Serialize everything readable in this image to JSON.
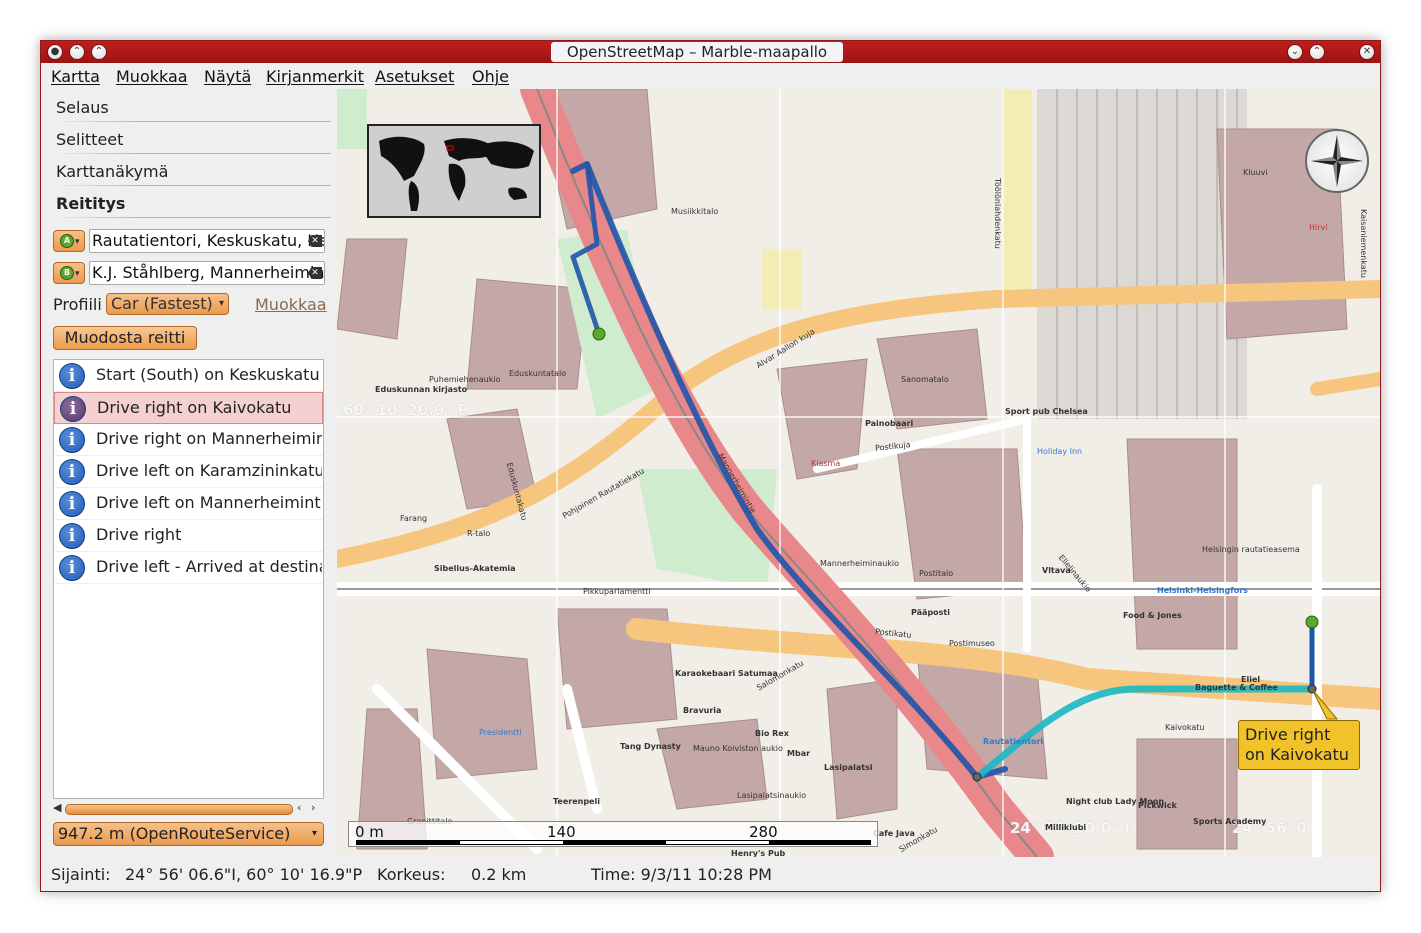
{
  "window": {
    "title": "OpenStreetMap – Marble-maapallo"
  },
  "menu": [
    "Kartta",
    "Muokkaa",
    "Näytä",
    "Kirjanmerkit",
    "Asetukset",
    "Ohje"
  ],
  "panel_tabs": [
    "Selaus",
    "Selitteet",
    "Karttanäkymä",
    "Reititys"
  ],
  "routing": {
    "start": "Rautatientori, Keskuskatu, Helsinki",
    "end": "K.J. Ståhlberg, Mannerheimintie",
    "start_pin": "A",
    "end_pin": "B",
    "profile_label": "Profiili",
    "profile": "Car (Fastest)",
    "edit_label": "Muokkaa",
    "calc_button": "Muodosta reitti",
    "instructions": [
      "Start (South) on Keskuskatu",
      "Drive right on Kaivokatu",
      "Drive right on Mannerheimintie",
      "Drive left on Karamzininkatu",
      "Drive left on Mannerheimintie",
      "Drive right",
      "Drive left - Arrived at destination"
    ],
    "selected_index": 1,
    "service": "947.2 m (OpenRouteService)"
  },
  "map": {
    "callout": "Drive right on Kaivokatu",
    "scale_labels": [
      "0 m",
      "140",
      "280"
    ],
    "grid_labels": [
      "60° 10' 20.0\" P",
      "24° 56' 20.0\" I",
      "24° 56' 0"
    ],
    "street_labels": [
      "Mannerheimintie",
      "Alvar Aallon kuja",
      "Postikatu",
      "Kaivokatu",
      "Salomonkatu",
      "Pohjoinen Rautatiekatu",
      "Eduskuntakatu",
      "Elielinaukio",
      "Postikuja",
      "Töölönlahdenkatu",
      "Kaisaniemenkatu",
      "Simonkatu",
      "Lasipalatsinaukio"
    ],
    "poi_labels": [
      "Musiikkitalo",
      "Eduskunnan kirjasto",
      "Puhemiehenaukio",
      "Eduskuntatalo",
      "Sanomatalo",
      "Painobaari",
      "Kiasma",
      "Sibelius-Akatemia",
      "R-talo",
      "Farang",
      "Pikkuparlamentti",
      "Mannerheiminaukio",
      "Postitalo",
      "Pääposti",
      "Holiday Inn",
      "Helsinki-Helsingfors",
      "Helsingin rautatieasema",
      "Vltava",
      "Sport pub Chelsea",
      "Food & Jones",
      "Eliel",
      "Baguette & Coffee",
      "Rautatientori",
      "Karaokebaari Satumaa",
      "Bravuria",
      "Tang Dynasty",
      "Bio Rex",
      "Mbar",
      "Lasipalatsi",
      "Mauno Koiviston aukio",
      "Presidentti",
      "Teerenpeli",
      "Granittitalo",
      "Cafe Java",
      "Henry's Pub",
      "Milliklubi",
      "Night club Lady Moon",
      "Pickwick",
      "Sports Academy",
      "Hirvi",
      "Kluuvi",
      "Postimuseo"
    ]
  },
  "status": {
    "position_label": "Sijainti:",
    "position": "24° 56' 06.6\"I,  60° 10' 16.9\"P",
    "altitude_label": "Korkeus:",
    "altitude": "0.2 km",
    "time": "Time: 9/3/11 10:28 PM"
  },
  "colors": {
    "titlebar": "#b01818",
    "accent_orange": "#ea9a4e",
    "route_blue": "#1f55a8",
    "route_cyan": "#1ab8c4",
    "selected_row": "#f4d0d0"
  }
}
